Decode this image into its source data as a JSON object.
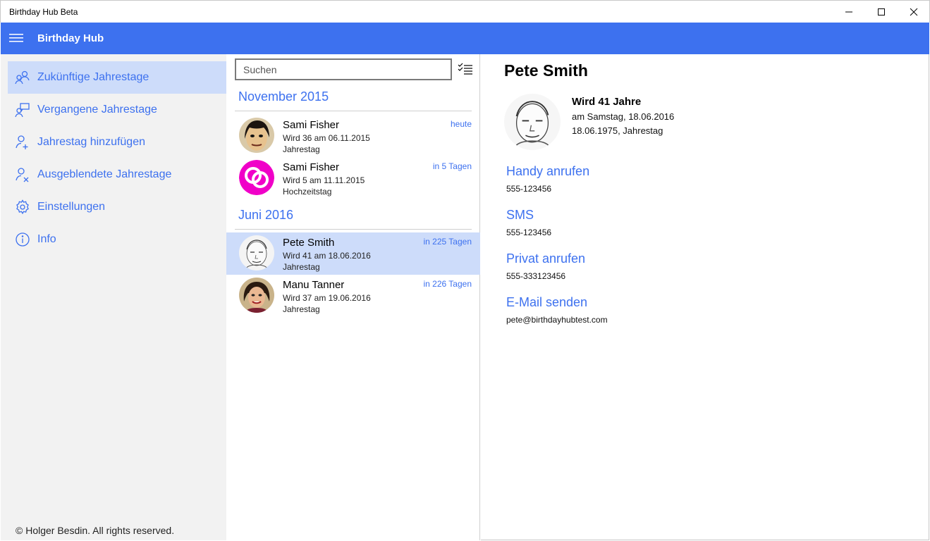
{
  "window": {
    "title": "Birthday Hub Beta"
  },
  "appbar": {
    "title": "Birthday Hub",
    "color": "#3d71ef"
  },
  "nav": {
    "items": [
      {
        "label": "Zukünftige Jahrestage",
        "icon": "people-icon",
        "active": true
      },
      {
        "label": "Vergangene Jahrestage",
        "icon": "person-chat-icon"
      },
      {
        "label": "Jahrestag hinzufügen",
        "icon": "add-person-icon"
      },
      {
        "label": "Ausgeblendete Jahrestage",
        "icon": "hidden-person-icon"
      },
      {
        "label": "Einstellungen",
        "icon": "gear-icon"
      },
      {
        "label": "Info",
        "icon": "info-icon"
      }
    ],
    "footer": "© Holger Besdin. All rights reserved."
  },
  "list": {
    "search_placeholder": "Suchen",
    "groups": [
      {
        "header": "November 2015",
        "rows": [
          {
            "name": "Sami Fisher",
            "line1": "Wird 36 am 06.11.2015",
            "line2": "Jahrestag",
            "when": "heute",
            "avatar": "photo-avatar"
          },
          {
            "name": "Sami Fisher",
            "line1": "Wird 5 am 11.11.2015",
            "line2": "Hochzeitstag",
            "when": "in 5 Tagen",
            "avatar": "wedding-rings-icon"
          }
        ]
      },
      {
        "header": "Juni 2016",
        "rows": [
          {
            "name": "Pete Smith",
            "line1": "Wird 41 am 18.06.2016",
            "line2": "Jahrestag",
            "when": "in 225 Tagen",
            "avatar": "sketch-avatar",
            "selected": true
          },
          {
            "name": "Manu Tanner",
            "line1": "Wird 37 am 19.06.2016",
            "line2": "Jahrestag",
            "when": "in 226 Tagen",
            "avatar": "photo-avatar"
          }
        ]
      }
    ]
  },
  "detail": {
    "name": "Pete Smith",
    "age_text": "Wird 41 Jahre",
    "on_text": "am Samstag, 18.06.2016",
    "date_text": "18.06.1975, Jahrestag",
    "actions": [
      {
        "label": "Handy anrufen",
        "value": "555-123456"
      },
      {
        "label": "SMS",
        "value": "555-123456"
      },
      {
        "label": "Privat anrufen",
        "value": "555-333123456"
      },
      {
        "label": "E-Mail senden",
        "value": "pete@birthdayhubtest.com"
      }
    ]
  }
}
